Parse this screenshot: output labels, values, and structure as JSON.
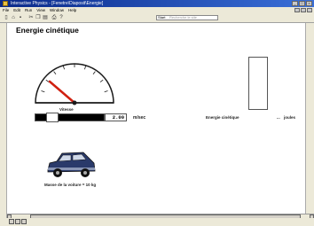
{
  "window": {
    "title": "Interactive Physics - [Fenetre\\Diaposit\\Energie]",
    "icon": "app-icon",
    "controls": [
      "minimize-icon",
      "maximize-icon",
      "close-icon"
    ]
  },
  "menu": {
    "items": [
      "File",
      "Edit",
      "Run",
      "View",
      "Window",
      "Help"
    ]
  },
  "toolbar": {
    "buttons": [
      "new-icon",
      "open-icon",
      "save-icon",
      "cut-icon",
      "copy-icon",
      "paste-icon",
      "print-icon",
      "help-icon"
    ],
    "search_go": "Start",
    "search_placeholder": "Recherche le site"
  },
  "sim": {
    "heading": "Energie cinétique",
    "gauge_label": "Vitesse",
    "speed_value": "2.00",
    "speed_unit": "m/sec",
    "slider_fraction": 0.2,
    "energy_label": "Energie cinétique",
    "energy_value": "...",
    "energy_unit": "joules",
    "mass_label": "Masse de la voiture = 10 kg",
    "colors": {
      "needle": "#d02010",
      "car_body": "#2a3a6a",
      "gauge_fill": "#ffffff"
    }
  }
}
